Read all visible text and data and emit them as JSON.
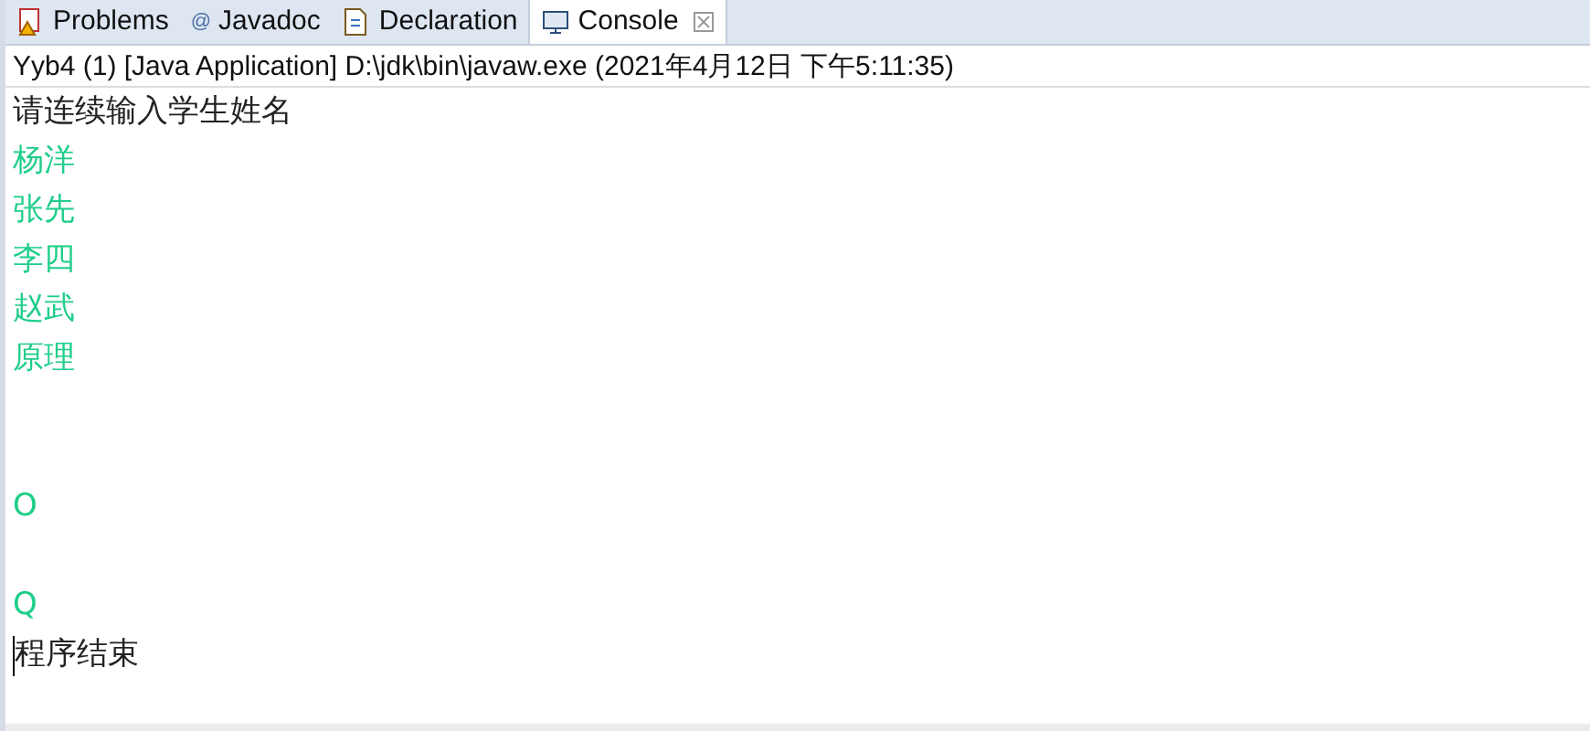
{
  "tabs": [
    {
      "label": "Problems",
      "kind": "problems",
      "selected": false
    },
    {
      "label": "Javadoc",
      "kind": "javadoc",
      "glyph": "@",
      "selected": false
    },
    {
      "label": "Declaration",
      "kind": "declaration",
      "selected": false
    },
    {
      "label": "Console",
      "kind": "console",
      "selected": true
    }
  ],
  "console": {
    "title": "Yyb4 (1) [Java Application] D:\\jdk\\bin\\javaw.exe (2021年4月12日 下午5:11:35)",
    "lines": [
      {
        "kind": "output",
        "text": "请连续输入学生姓名"
      },
      {
        "kind": "input",
        "text": "杨洋"
      },
      {
        "kind": "input",
        "text": "张先"
      },
      {
        "kind": "input",
        "text": "李四"
      },
      {
        "kind": "input",
        "text": "赵武"
      },
      {
        "kind": "input",
        "text": "原理"
      },
      {
        "kind": "blank"
      },
      {
        "kind": "blank"
      },
      {
        "kind": "input",
        "text": "O"
      },
      {
        "kind": "blank"
      },
      {
        "kind": "input",
        "text": "Q"
      },
      {
        "kind": "output",
        "text": "程序结束",
        "caret": true
      }
    ]
  }
}
